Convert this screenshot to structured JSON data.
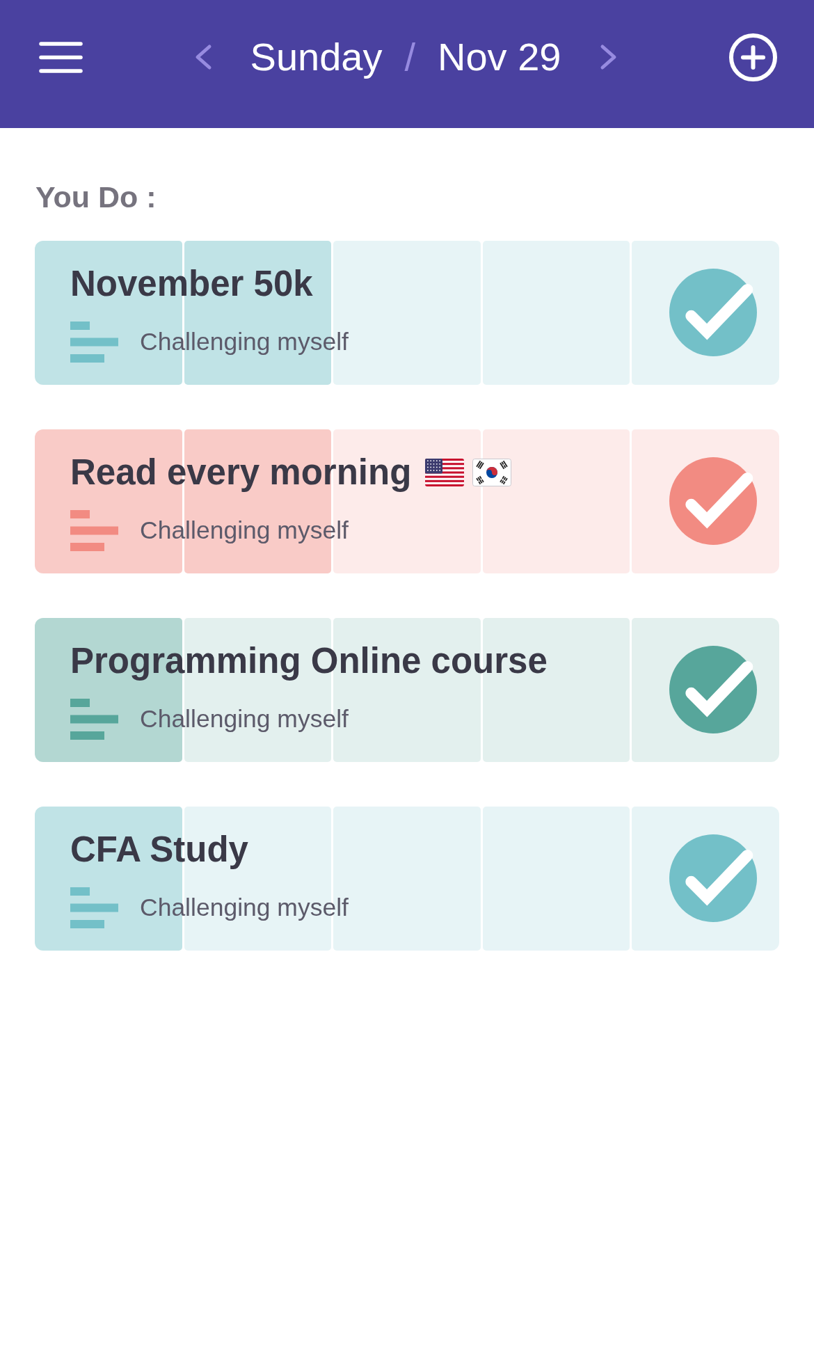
{
  "header": {
    "day": "Sunday",
    "separator": "/",
    "date": "Nov 29"
  },
  "section_title": "You Do :",
  "tasks": [
    {
      "title": "November 50k",
      "subtitle": "Challenging myself",
      "color": "#73c0c8",
      "checked": true,
      "segments": [
        {
          "filled": true
        },
        {
          "filled": true
        },
        {
          "filled": false
        },
        {
          "filled": false
        },
        {
          "filled": false
        }
      ]
    },
    {
      "title": "Read every morning",
      "emoji": [
        {
          "kind": "us_flag"
        },
        {
          "kind": "kr_flag"
        }
      ],
      "subtitle": "Challenging myself",
      "color": "#f28b82",
      "checked": true,
      "segments": [
        {
          "filled": true
        },
        {
          "filled": true
        },
        {
          "filled": false
        },
        {
          "filled": false
        },
        {
          "filled": false
        }
      ]
    },
    {
      "title": "Programming Online course",
      "subtitle": "Challenging myself",
      "color": "#57a69b",
      "checked": true,
      "segments": [
        {
          "filled": true
        },
        {
          "filled": false
        },
        {
          "filled": false
        },
        {
          "filled": false
        },
        {
          "filled": false
        }
      ]
    },
    {
      "title": "CFA Study",
      "subtitle": "Challenging myself",
      "color": "#73c0c8",
      "checked": true,
      "segments": [
        {
          "filled": true
        },
        {
          "filled": false
        },
        {
          "filled": false
        },
        {
          "filled": false
        },
        {
          "filled": false
        }
      ]
    }
  ]
}
